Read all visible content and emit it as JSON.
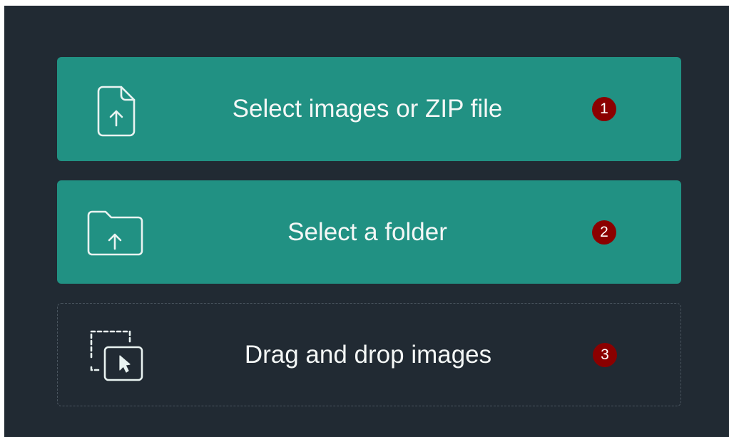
{
  "options": [
    {
      "label": "Select images or ZIP file",
      "badge": "1",
      "icon": "file-upload-icon"
    },
    {
      "label": "Select a folder",
      "badge": "2",
      "icon": "folder-upload-icon"
    },
    {
      "label": "Drag and drop images",
      "badge": "3",
      "icon": "drag-drop-icon"
    }
  ],
  "colors": {
    "panel_bg": "#212a33",
    "button_bg": "#219183",
    "badge_bg": "#8b0000",
    "text": "#f4f7f6"
  }
}
